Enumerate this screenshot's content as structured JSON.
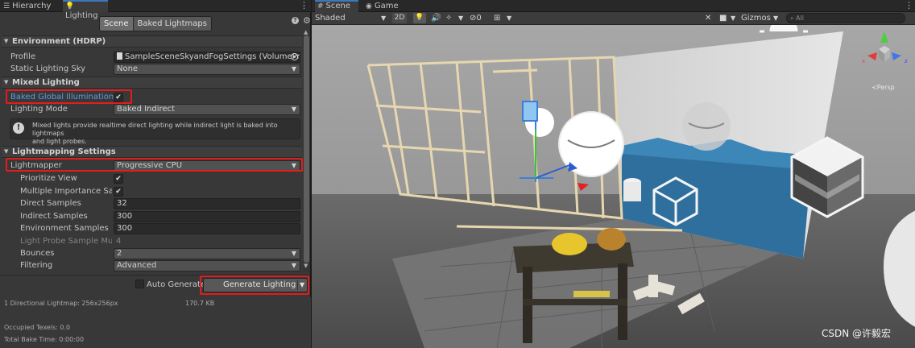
{
  "left_panel": {
    "tabs": [
      {
        "label": "Hierarchy",
        "icon": "list-icon",
        "active": false
      },
      {
        "label": "Lighting",
        "icon": "lightbulb-icon",
        "active": true
      }
    ],
    "mode_toggle": {
      "scene": "Scene",
      "baked": "Baked Lightmaps"
    },
    "environment": {
      "title": "Environment (HDRP)",
      "profile_label": "Profile",
      "profile_value": "SampleSceneSkyandFogSettings (VolumeProfi",
      "static_sky_label": "Static Lighting Sky",
      "static_sky_value": "None"
    },
    "mixed": {
      "title": "Mixed Lighting",
      "baked_gi_label": "Baked Global Illumination",
      "baked_gi_check": "✔",
      "lighting_mode_label": "Lighting Mode",
      "lighting_mode_value": "Baked Indirect",
      "info_line1": "Mixed lights provide realtime direct lighting while indirect light is baked into lightmaps",
      "info_line2": "and light probes."
    },
    "lightmapping": {
      "title": "Lightmapping Settings",
      "lightmapper_label": "Lightmapper",
      "lightmapper_value": "Progressive CPU",
      "prioritize_label": "Prioritize View",
      "prioritize_check": "✔",
      "mis_label": "Multiple Importance Samp",
      "mis_check": "✔",
      "direct_label": "Direct Samples",
      "direct_value": "32",
      "indirect_label": "Indirect Samples",
      "indirect_value": "300",
      "env_label": "Environment Samples",
      "env_value": "300",
      "probe_mult_label": "Light Probe Sample Multip",
      "probe_mult_value": "4",
      "bounces_label": "Bounces",
      "bounces_value": "2",
      "filtering_label": "Filtering",
      "filtering_value": "Advanced"
    },
    "bottom": {
      "auto_generate_label": "Auto Generate",
      "generate_button": "Generate Lighting",
      "stat_lightmaps": "1 Directional Lightmap: 256x256px",
      "stat_size": "170.7 KB",
      "stat_texels": "Occupied Texels: 0.0",
      "stat_bake_time": "Total Bake Time: 0:00:00"
    }
  },
  "scene_view": {
    "tabs": [
      {
        "label": "Scene",
        "icon": "hash-icon",
        "active": true
      },
      {
        "label": "Game",
        "icon": "gamepad-icon",
        "active": false
      }
    ],
    "toolbar": {
      "shading": "Shaded",
      "mode_2d": "2D",
      "hidden_count": "0",
      "gizmos": "Gizmos",
      "search_placeholder": "All"
    },
    "persp_label": "≺Persp",
    "watermark": "CSDN @许毅宏"
  },
  "colors": {
    "highlight_red": "#e41c1c",
    "link_blue": "#5a9be6",
    "panel_bg": "#383838",
    "header_bg": "#282828"
  }
}
